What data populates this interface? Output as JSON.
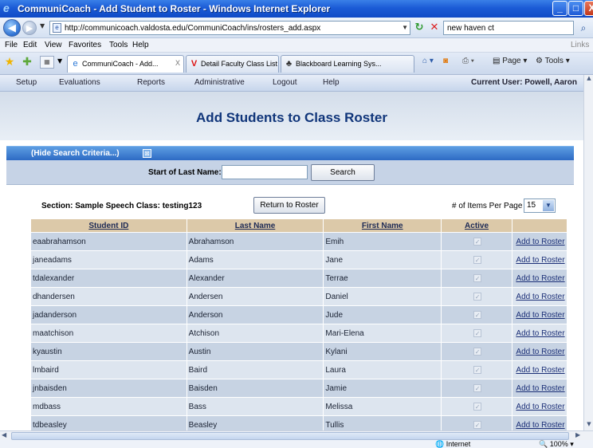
{
  "window": {
    "title": "CommuniCoach - Add Student to Roster - Windows Internet Explorer",
    "min_glyph": "_",
    "max_glyph": "□",
    "close_glyph": "X"
  },
  "address_bar": {
    "url": "http://communicoach.valdosta.edu/CommuniCoach/ins/rosters_add.aspx",
    "search_value": "new haven ct"
  },
  "menu": {
    "items": [
      "File",
      "Edit",
      "View",
      "Favorites",
      "Tools",
      "Help"
    ],
    "links": "Links"
  },
  "tabs": [
    {
      "label": "CommuniCoach - Add...",
      "close": "X",
      "icon": "ie-page-icon"
    },
    {
      "label": "Detail Faculty Class List",
      "icon": "v-logo-icon"
    },
    {
      "label": "Blackboard Learning Sys...",
      "icon": "blackboard-icon"
    }
  ],
  "command_bar": {
    "page": "Page",
    "tools": "Tools"
  },
  "app_nav": {
    "items": [
      "Setup",
      "Evaluations",
      "Reports",
      "Administrative",
      "Logout",
      "Help"
    ],
    "current_user": "Current User: Powell, Aaron"
  },
  "page": {
    "title": "Add Students to Class Roster",
    "hide_search": "(Hide Search Criteria...)",
    "last_name_label": "Start of Last Name:",
    "last_name_value": "",
    "search_button": "Search",
    "section_label": "Section: Sample Speech Class: testing123",
    "return_button": "Return to Roster",
    "per_page_label": "# of Items Per Page",
    "per_page_value": "15"
  },
  "table": {
    "headers": [
      "Student ID",
      "Last Name",
      "First Name",
      "Active",
      ""
    ],
    "action_label": "Add to Roster",
    "rows": [
      {
        "id": "eaabrahamson",
        "last": "Abrahamson",
        "first": "Emih",
        "active": true
      },
      {
        "id": "janeadams",
        "last": "Adams",
        "first": "Jane",
        "active": true
      },
      {
        "id": "tdalexander",
        "last": "Alexander",
        "first": "Terrae",
        "active": true
      },
      {
        "id": "dhandersen",
        "last": "Andersen",
        "first": "Daniel",
        "active": true
      },
      {
        "id": "jadanderson",
        "last": "Anderson",
        "first": "Jude",
        "active": true
      },
      {
        "id": "maatchison",
        "last": "Atchison",
        "first": "Mari-Elena",
        "active": true
      },
      {
        "id": "kyaustin",
        "last": "Austin",
        "first": "Kylani",
        "active": true
      },
      {
        "id": "lmbaird",
        "last": "Baird",
        "first": "Laura",
        "active": true
      },
      {
        "id": "jnbaisden",
        "last": "Baisden",
        "first": "Jamie",
        "active": true
      },
      {
        "id": "mdbass",
        "last": "Bass",
        "first": "Melissa",
        "active": true
      },
      {
        "id": "tdbeasley",
        "last": "Beasley",
        "first": "Tullis",
        "active": true
      }
    ]
  },
  "status": {
    "zone": "Internet",
    "zoom": "100%"
  },
  "colors": {
    "title_band": "#10357a",
    "header_row": "#dcc9a9",
    "row_odd": "#c7d3e3",
    "row_even": "#dde5ef",
    "hide_bar": "#2d6ac4"
  }
}
